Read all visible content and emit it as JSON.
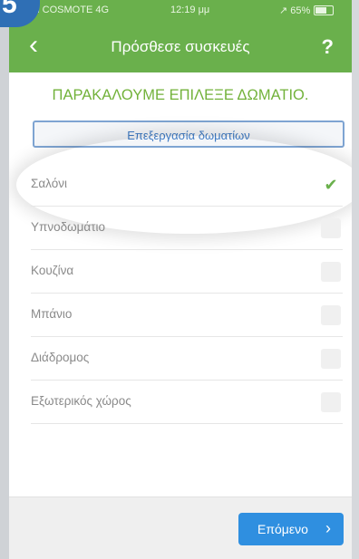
{
  "badge": {
    "text": "5"
  },
  "status_bar": {
    "carrier": "ıııl COSMOTE  4G",
    "time": "12:19 μμ",
    "battery": "↗ 65%"
  },
  "nav": {
    "back_icon": "‹",
    "title": "Πρόσθεσε συσκευές",
    "help": "?"
  },
  "prompt": "ΠΑΡΑΚΑΛΟΥΜΕ ΕΠΙΛΕΞΕ ΔΩΜΑΤΙΟ.",
  "edit_rooms_label": "Επεξεργασία δωματίων",
  "rooms": [
    {
      "label": "Σαλόνι",
      "selected": true
    },
    {
      "label": "Υπνοδωμάτιο",
      "selected": false
    },
    {
      "label": "Κουζίνα",
      "selected": false
    },
    {
      "label": "Μπάνιο",
      "selected": false
    },
    {
      "label": "Διάδρομος",
      "selected": false
    },
    {
      "label": "Εξωτερικός χώρος",
      "selected": false
    }
  ],
  "footer": {
    "next_label": "Επόμενο",
    "next_arrow": "›"
  },
  "colors": {
    "header": "#6ab04c",
    "accent_text": "#72b23a",
    "button": "#2f8fe0",
    "link": "#3f7bc4"
  }
}
